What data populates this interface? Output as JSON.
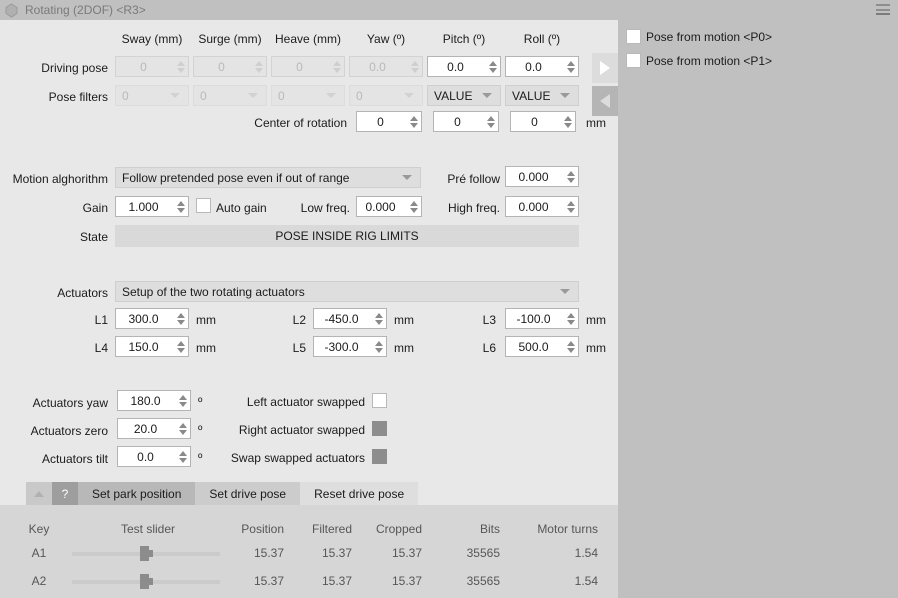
{
  "window": {
    "title": "Rotating (2DOF) <R3>",
    "app_icon": "polygon-gem-icon",
    "menu_icon": "hamburger-menu-icon"
  },
  "pose_table": {
    "headers": [
      "Sway (mm)",
      "Surge (mm)",
      "Heave (mm)",
      "Yaw (º)",
      "Pitch (º)",
      "Roll (º)"
    ],
    "rows": [
      {
        "label": "Driving pose",
        "values": [
          "0",
          "0",
          "0",
          "0.0",
          "0.0",
          "0.0"
        ],
        "disabled": [
          true,
          true,
          true,
          true,
          false,
          false
        ]
      },
      {
        "label": "Pose filters",
        "values": [
          "0",
          "0",
          "0",
          "0",
          "VALUE",
          "VALUE"
        ],
        "disabled": [
          true,
          true,
          true,
          true,
          false,
          false
        ]
      }
    ],
    "center_of_rotation": {
      "label": "Center of rotation",
      "values": [
        "0",
        "0",
        "0"
      ],
      "unit": "mm"
    },
    "nav": {
      "next_icon": "triangle-right-icon",
      "prev_icon": "triangle-left-icon"
    }
  },
  "motion": {
    "algorithm_label": "Motion alghorithm",
    "algorithm_value": "Follow pretended pose even if out of range",
    "pre_follow_label": "Pré follow",
    "pre_follow_value": "0.000",
    "gain_label": "Gain",
    "gain_value": "1.000",
    "auto_gain_label": "Auto gain",
    "auto_gain_checked": false,
    "low_freq_label": "Low freq.",
    "low_freq_value": "0.000",
    "high_freq_label": "High freq.",
    "high_freq_value": "0.000",
    "state_label": "State",
    "state_value": "POSE INSIDE RIG LIMITS"
  },
  "actuators": {
    "label": "Actuators",
    "setup_value": "Setup of the two rotating actuators",
    "lengths": [
      {
        "label": "L1",
        "value": "300.0",
        "unit": "mm"
      },
      {
        "label": "L2",
        "value": "-450.0",
        "unit": "mm"
      },
      {
        "label": "L3",
        "value": "-100.0",
        "unit": "mm"
      },
      {
        "label": "L4",
        "value": "150.0",
        "unit": "mm"
      },
      {
        "label": "L5",
        "value": "-300.0",
        "unit": "mm"
      },
      {
        "label": "L6",
        "value": "500.0",
        "unit": "mm"
      }
    ],
    "angles": [
      {
        "label": "Actuators yaw",
        "value": "180.0",
        "unit": "º"
      },
      {
        "label": "Actuators zero",
        "value": "20.0",
        "unit": "º"
      },
      {
        "label": "Actuators tilt",
        "value": "0.0",
        "unit": "º"
      }
    ],
    "swaps": [
      {
        "label": "Left actuator swapped",
        "filled": false
      },
      {
        "label": "Right actuator swapped",
        "filled": true
      },
      {
        "label": "Swap swapped actuators",
        "filled": true
      }
    ]
  },
  "buttons": {
    "collapse_icon": "triangle-up-icon",
    "help_label": "?",
    "set_park_position": "Set park position",
    "set_drive_pose": "Set drive pose",
    "reset_drive_pose": "Reset drive pose"
  },
  "status_table": {
    "headers": [
      "Key",
      "Test slider",
      "Position",
      "Filtered",
      "Cropped",
      "Bits",
      "Motor turns"
    ],
    "rows": [
      {
        "key": "A1",
        "slider": 52,
        "position": "15.37",
        "filtered": "15.37",
        "cropped": "15.37",
        "bits": "35565",
        "motor_turns": "1.54"
      },
      {
        "key": "A2",
        "slider": 52,
        "position": "15.37",
        "filtered": "15.37",
        "cropped": "15.37",
        "bits": "35565",
        "motor_turns": "1.54"
      }
    ]
  },
  "right_pane": {
    "checkboxes": [
      {
        "label": "Pose from motion <P0>",
        "checked": false
      },
      {
        "label": "Pose from motion <P1>",
        "checked": false
      }
    ]
  },
  "colors": {
    "panel_bg": "#e8e8e8",
    "window_bg": "#c0c0c0",
    "table_bg": "#d6d6d6",
    "state_bg": "#d9d9d9"
  }
}
